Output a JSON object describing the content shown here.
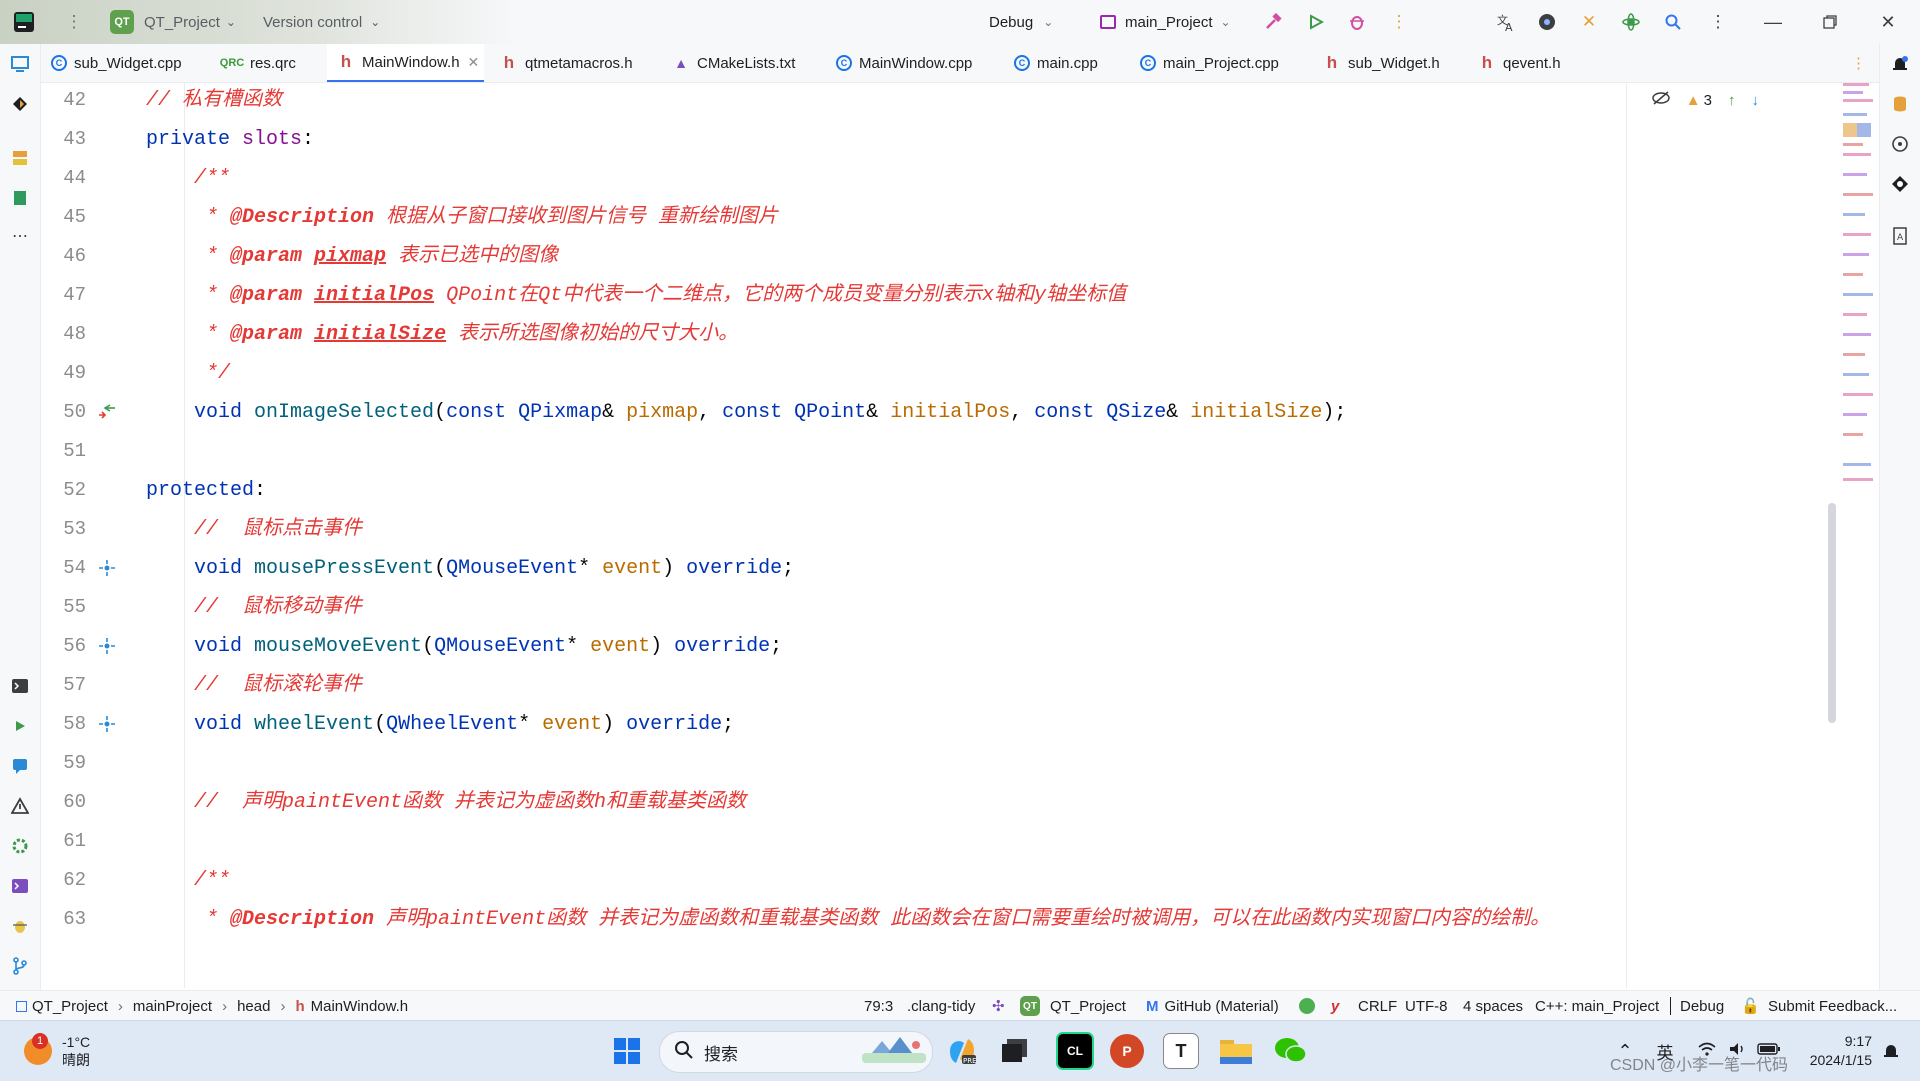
{
  "titlebar": {
    "project_badge": "QT",
    "project_name": "QT_Project",
    "vcs": "Version control",
    "run_config": "Debug",
    "target": "main_Project"
  },
  "tabs": [
    {
      "label": "sub_Widget.cpp",
      "icon": "cpp-file-icon"
    },
    {
      "label": "res.qrc",
      "icon": "qrc-file-icon"
    },
    {
      "label": "MainWindow.h",
      "icon": "header-file-icon",
      "active": true
    },
    {
      "label": "qtmetamacros.h",
      "icon": "header-file-icon"
    },
    {
      "label": "CMakeLists.txt",
      "icon": "cmake-file-icon"
    },
    {
      "label": "MainWindow.cpp",
      "icon": "cpp-file-icon"
    },
    {
      "label": "main.cpp",
      "icon": "cpp-file-icon"
    },
    {
      "label": "main_Project.cpp",
      "icon": "cpp-file-icon"
    },
    {
      "label": "sub_Widget.h",
      "icon": "header-file-icon"
    },
    {
      "label": "qevent.h",
      "icon": "header-file-icon"
    }
  ],
  "inspections": {
    "warnings": "3"
  },
  "code": {
    "l42": {
      "n": "42",
      "c": "// 私有槽函数"
    },
    "l43": {
      "n": "43",
      "kw": "private ",
      "mac": "slots",
      "p": ":"
    },
    "l44": {
      "n": "44",
      "c": "    /**"
    },
    "l45": {
      "n": "45",
      "star": "     * ",
      "tag": "@Description",
      "c": " 根据从子窗口接收到图片信号 重新绘制图片"
    },
    "l46": {
      "n": "46",
      "star": "     * ",
      "tag": "@param",
      "arg": "pixmap",
      "c": " 表示已选中的图像"
    },
    "l47": {
      "n": "47",
      "star": "     * ",
      "tag": "@param",
      "arg": "initialPos",
      "c": " QPoint在Qt中代表一个二维点，它的两个成员变量分别表示x轴和y轴坐标值"
    },
    "l48": {
      "n": "48",
      "star": "     * ",
      "tag": "@param",
      "arg": "initialSize",
      "c": " 表示所选图像初始的尺寸大小。"
    },
    "l49": {
      "n": "49",
      "c": "     */"
    },
    "l50": {
      "n": "50",
      "void": "    void ",
      "fn": "onImageSelected",
      "o": "(",
      "k1": "const ",
      "t1": "QPixmap",
      "a1": "& ",
      "p1": "pixmap",
      "s1": ", ",
      "k2": "const ",
      "t2": "QPoint",
      "a2": "& ",
      "p2": "initialPos",
      "s2": ", ",
      "k3": "const ",
      "t3": "QSize",
      "a3": "& ",
      "p3": "initialSize",
      "e": ");"
    },
    "l51": {
      "n": "51"
    },
    "l52": {
      "n": "52",
      "kw": "protected",
      "p": ":"
    },
    "l53": {
      "n": "53",
      "c": "    //  鼠标点击事件"
    },
    "l54": {
      "n": "54",
      "void": "    void ",
      "fn": "mousePressEvent",
      "o": "(",
      "t1": "QMouseEvent",
      "a1": "* ",
      "p1": "event",
      "cl": ") ",
      "ov": "override",
      "e": ";"
    },
    "l55": {
      "n": "55",
      "c": "    //  鼠标移动事件"
    },
    "l56": {
      "n": "56",
      "void": "    void ",
      "fn": "mouseMoveEvent",
      "o": "(",
      "t1": "QMouseEvent",
      "a1": "* ",
      "p1": "event",
      "cl": ") ",
      "ov": "override",
      "e": ";"
    },
    "l57": {
      "n": "57",
      "c": "    //  鼠标滚轮事件"
    },
    "l58": {
      "n": "58",
      "void": "    void ",
      "fn": "wheelEvent",
      "o": "(",
      "t1": "QWheelEvent",
      "a1": "* ",
      "p1": "event",
      "cl": ") ",
      "ov": "override",
      "e": ";"
    },
    "l59": {
      "n": "59"
    },
    "l60": {
      "n": "60",
      "c": "    //  声明paintEvent函数 并表记为虚函数h和重载基类函数"
    },
    "l61": {
      "n": "61"
    },
    "l62": {
      "n": "62",
      "c": "    /**"
    },
    "l63": {
      "n": "63",
      "star": "     * ",
      "tag": "@Description",
      "c": " 声明paintEvent函数 并表记为虚函数和重载基类函数 此函数会在窗口需要重绘时被调用，可以在此函数内实现窗口内容的绘制。"
    }
  },
  "statusbar": {
    "crumbs": [
      "QT_Project",
      "mainProject",
      "head",
      "MainWindow.h"
    ],
    "position": "79:3",
    "linter": ".clang-tidy",
    "qt_badge": "QT",
    "qt_project": "QT_Project",
    "theme": "GitHub (Material)",
    "line_ending": "CRLF",
    "encoding": "UTF-8",
    "indent": "4 spaces",
    "context": "C++: main_Project",
    "config": "Debug",
    "feedback": "Submit Feedback..."
  },
  "taskbar": {
    "weather_badge": "1",
    "temperature": "-1°C",
    "condition": "晴朗",
    "search_placeholder": "搜索",
    "input_method": "英",
    "time": "9:17",
    "date": "2024/1/15",
    "watermark": "CSDN @小李一笔一代码"
  },
  "colors": {
    "accent": "#3574f0",
    "comment": "#e53935",
    "keyword": "#0033b3",
    "param": "#ba6b00",
    "function": "#00627a"
  }
}
